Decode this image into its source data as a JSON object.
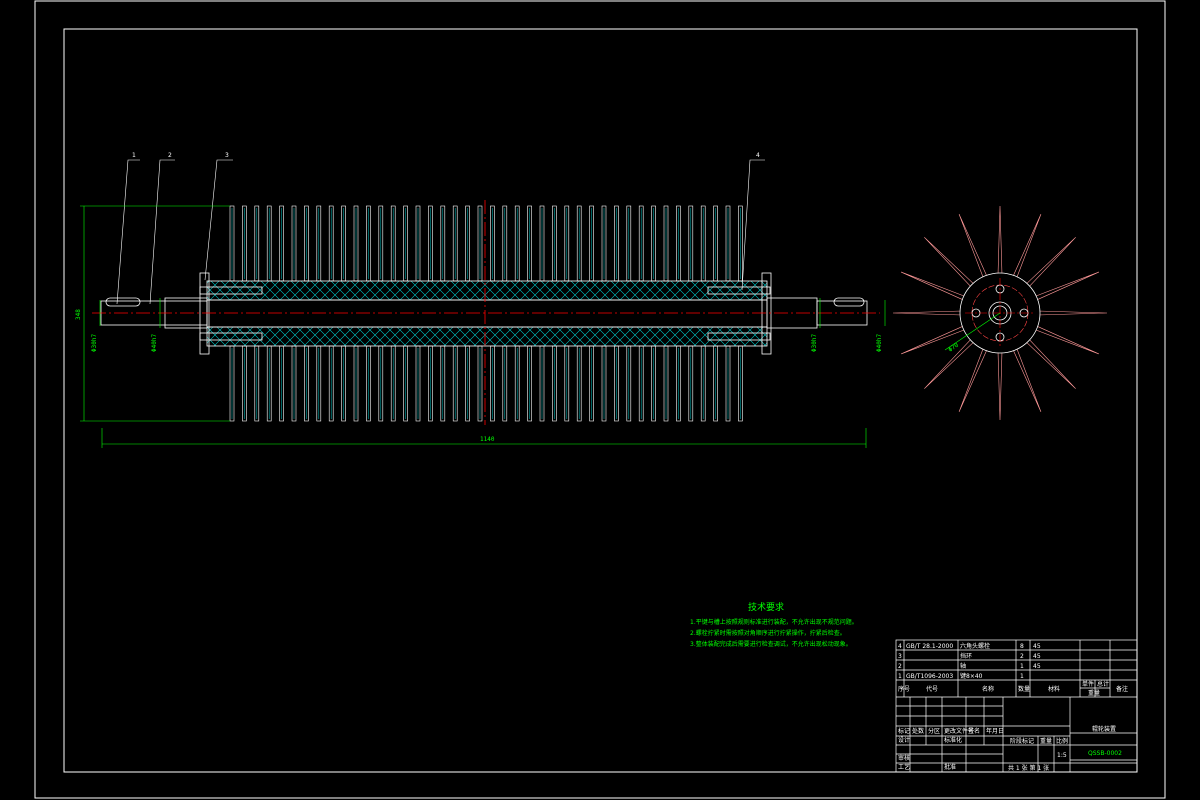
{
  "drawing": {
    "part_labels": [
      "1",
      "2",
      "3",
      "4"
    ],
    "dim_overall_length": "1140",
    "dim_height": "348",
    "dim_shaft_left_1": "Φ30h7",
    "dim_shaft_left_2": "Φ40h7",
    "dim_shaft_right_1": "Φ30h7",
    "dim_shaft_right_2": "Φ40h7",
    "dim_hub_dia": "Φ70"
  },
  "tech_req": {
    "title": "技术要求",
    "lines": [
      "1.平键与槽上按照规则标准进行装配，不允许出现不规范问题。",
      "2.螺栓拧紧时需按照对角顺序进行拧紧操作，拧紧后检查。",
      "3.整体装配完成后需要进行检查调试，不允许出现松动现象。"
    ]
  },
  "bom": {
    "rows": [
      {
        "no": "4",
        "code": "GB/T 28.1-2000",
        "name": "六角头螺栓",
        "qty": "8",
        "mat": "45"
      },
      {
        "no": "3",
        "code": "",
        "name": "挡环",
        "qty": "2",
        "mat": "45"
      },
      {
        "no": "2",
        "code": "",
        "name": "轴",
        "qty": "1",
        "mat": "45"
      },
      {
        "no": "1",
        "code": "GB/T1096-2003",
        "name": "键8×40",
        "qty": "1",
        "mat": ""
      }
    ],
    "header": {
      "no": "序号",
      "code": "代号",
      "name": "名称",
      "qty": "数量",
      "mat": "材料",
      "unit": "单件",
      "total": "总计",
      "weight": "重量",
      "remark": "备注"
    }
  },
  "title_block": {
    "drawing_title": "辊轮装置",
    "drawing_no": "QSSB-0002",
    "scale": "1:5",
    "sheet": "共 1 张  第 1 张",
    "labels": {
      "design": "设计",
      "review": "审核",
      "process": "工艺",
      "standard": "标准化",
      "approve": "批准",
      "stage": "阶段标记",
      "weight": "重量",
      "scale": "比例",
      "mark": "标记",
      "zones": "处数",
      "partition": "分区",
      "change_doc": "更改文件号",
      "sign": "签名",
      "date": "年月日"
    }
  },
  "colors": {
    "frame": "#ffffff",
    "dimension": "#00ff00",
    "centerline": "#ff0000",
    "hatch": "#00ffff",
    "spoke": "#ff6666"
  }
}
